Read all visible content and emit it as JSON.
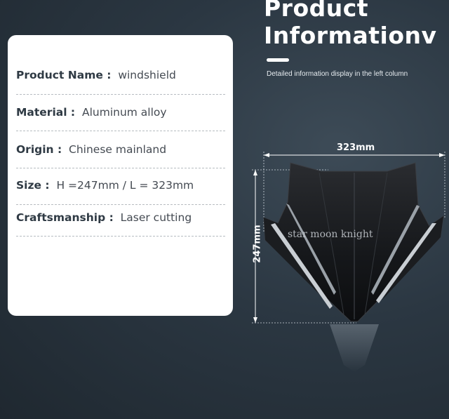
{
  "header": {
    "title_line1": "Product",
    "title_line2": "Informationv",
    "subtitle": "Detailed information display in the left column"
  },
  "specs": [
    {
      "key": "Product Name :",
      "value": "windshield"
    },
    {
      "key": "Material :",
      "value": "Aluminum alloy"
    },
    {
      "key": "Origin :",
      "value": "Chinese mainland"
    },
    {
      "key": "Size :",
      "value": "H =247mm / L = 323mm"
    },
    {
      "key": "Craftsmanship :",
      "value": "Laser cutting"
    }
  ],
  "product_image": {
    "width_label": "323mm",
    "height_label": "247mm",
    "watermark": "star moon knight"
  }
}
